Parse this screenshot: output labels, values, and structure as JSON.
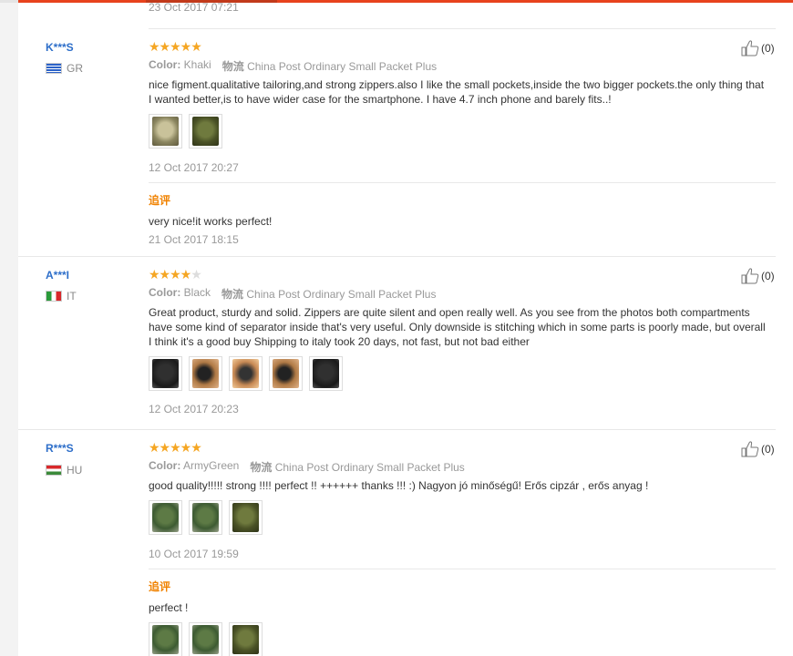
{
  "top_date": "23 Oct 2017 07:21",
  "labels": {
    "color": "Color:",
    "shipping_icon": "物流",
    "additional_feedback": "追评"
  },
  "reviews": [
    {
      "user": "K***S",
      "country": "GR",
      "rating": 5,
      "color": "Khaki",
      "shipping": "China Post Ordinary Small Packet Plus",
      "text": "nice figment.qualitative tailoring,and strong zippers.also I like the small pockets,inside the two bigger pockets.the only thing that I wanted better,is to have wider case for the smartphone. I have 4.7 inch phone and barely fits..!",
      "date": "12 Oct 2017 20:27",
      "likes": "(0)",
      "followup": {
        "text": "very nice!it works perfect!",
        "date": "21 Oct 2017 18:15"
      }
    },
    {
      "user": "A***I",
      "country": "IT",
      "rating": 4,
      "color": "Black",
      "shipping": "China Post Ordinary Small Packet Plus",
      "text": "Great product, sturdy and solid. Zippers are quite silent and open really well. As you see from the photos both compartments have some kind of separator inside that's very useful. Only downside is stitching which in some parts is poorly made, but overall I think it's a good buy Shipping to italy took 20 days, not fast, but not bad either",
      "date": "12 Oct 2017 20:23",
      "likes": "(0)"
    },
    {
      "user": "R***S",
      "country": "HU",
      "rating": 5,
      "color": "ArmyGreen",
      "shipping": "China Post Ordinary Small Packet Plus",
      "text": "good quality!!!!! strong !!!! perfect !! ++++++ thanks !!! :) Nagyon jó minőségű! Erős cipzár , erős anyag !",
      "date": "10 Oct 2017 19:59",
      "likes": "(0)",
      "followup": {
        "text": "perfect !"
      }
    }
  ]
}
